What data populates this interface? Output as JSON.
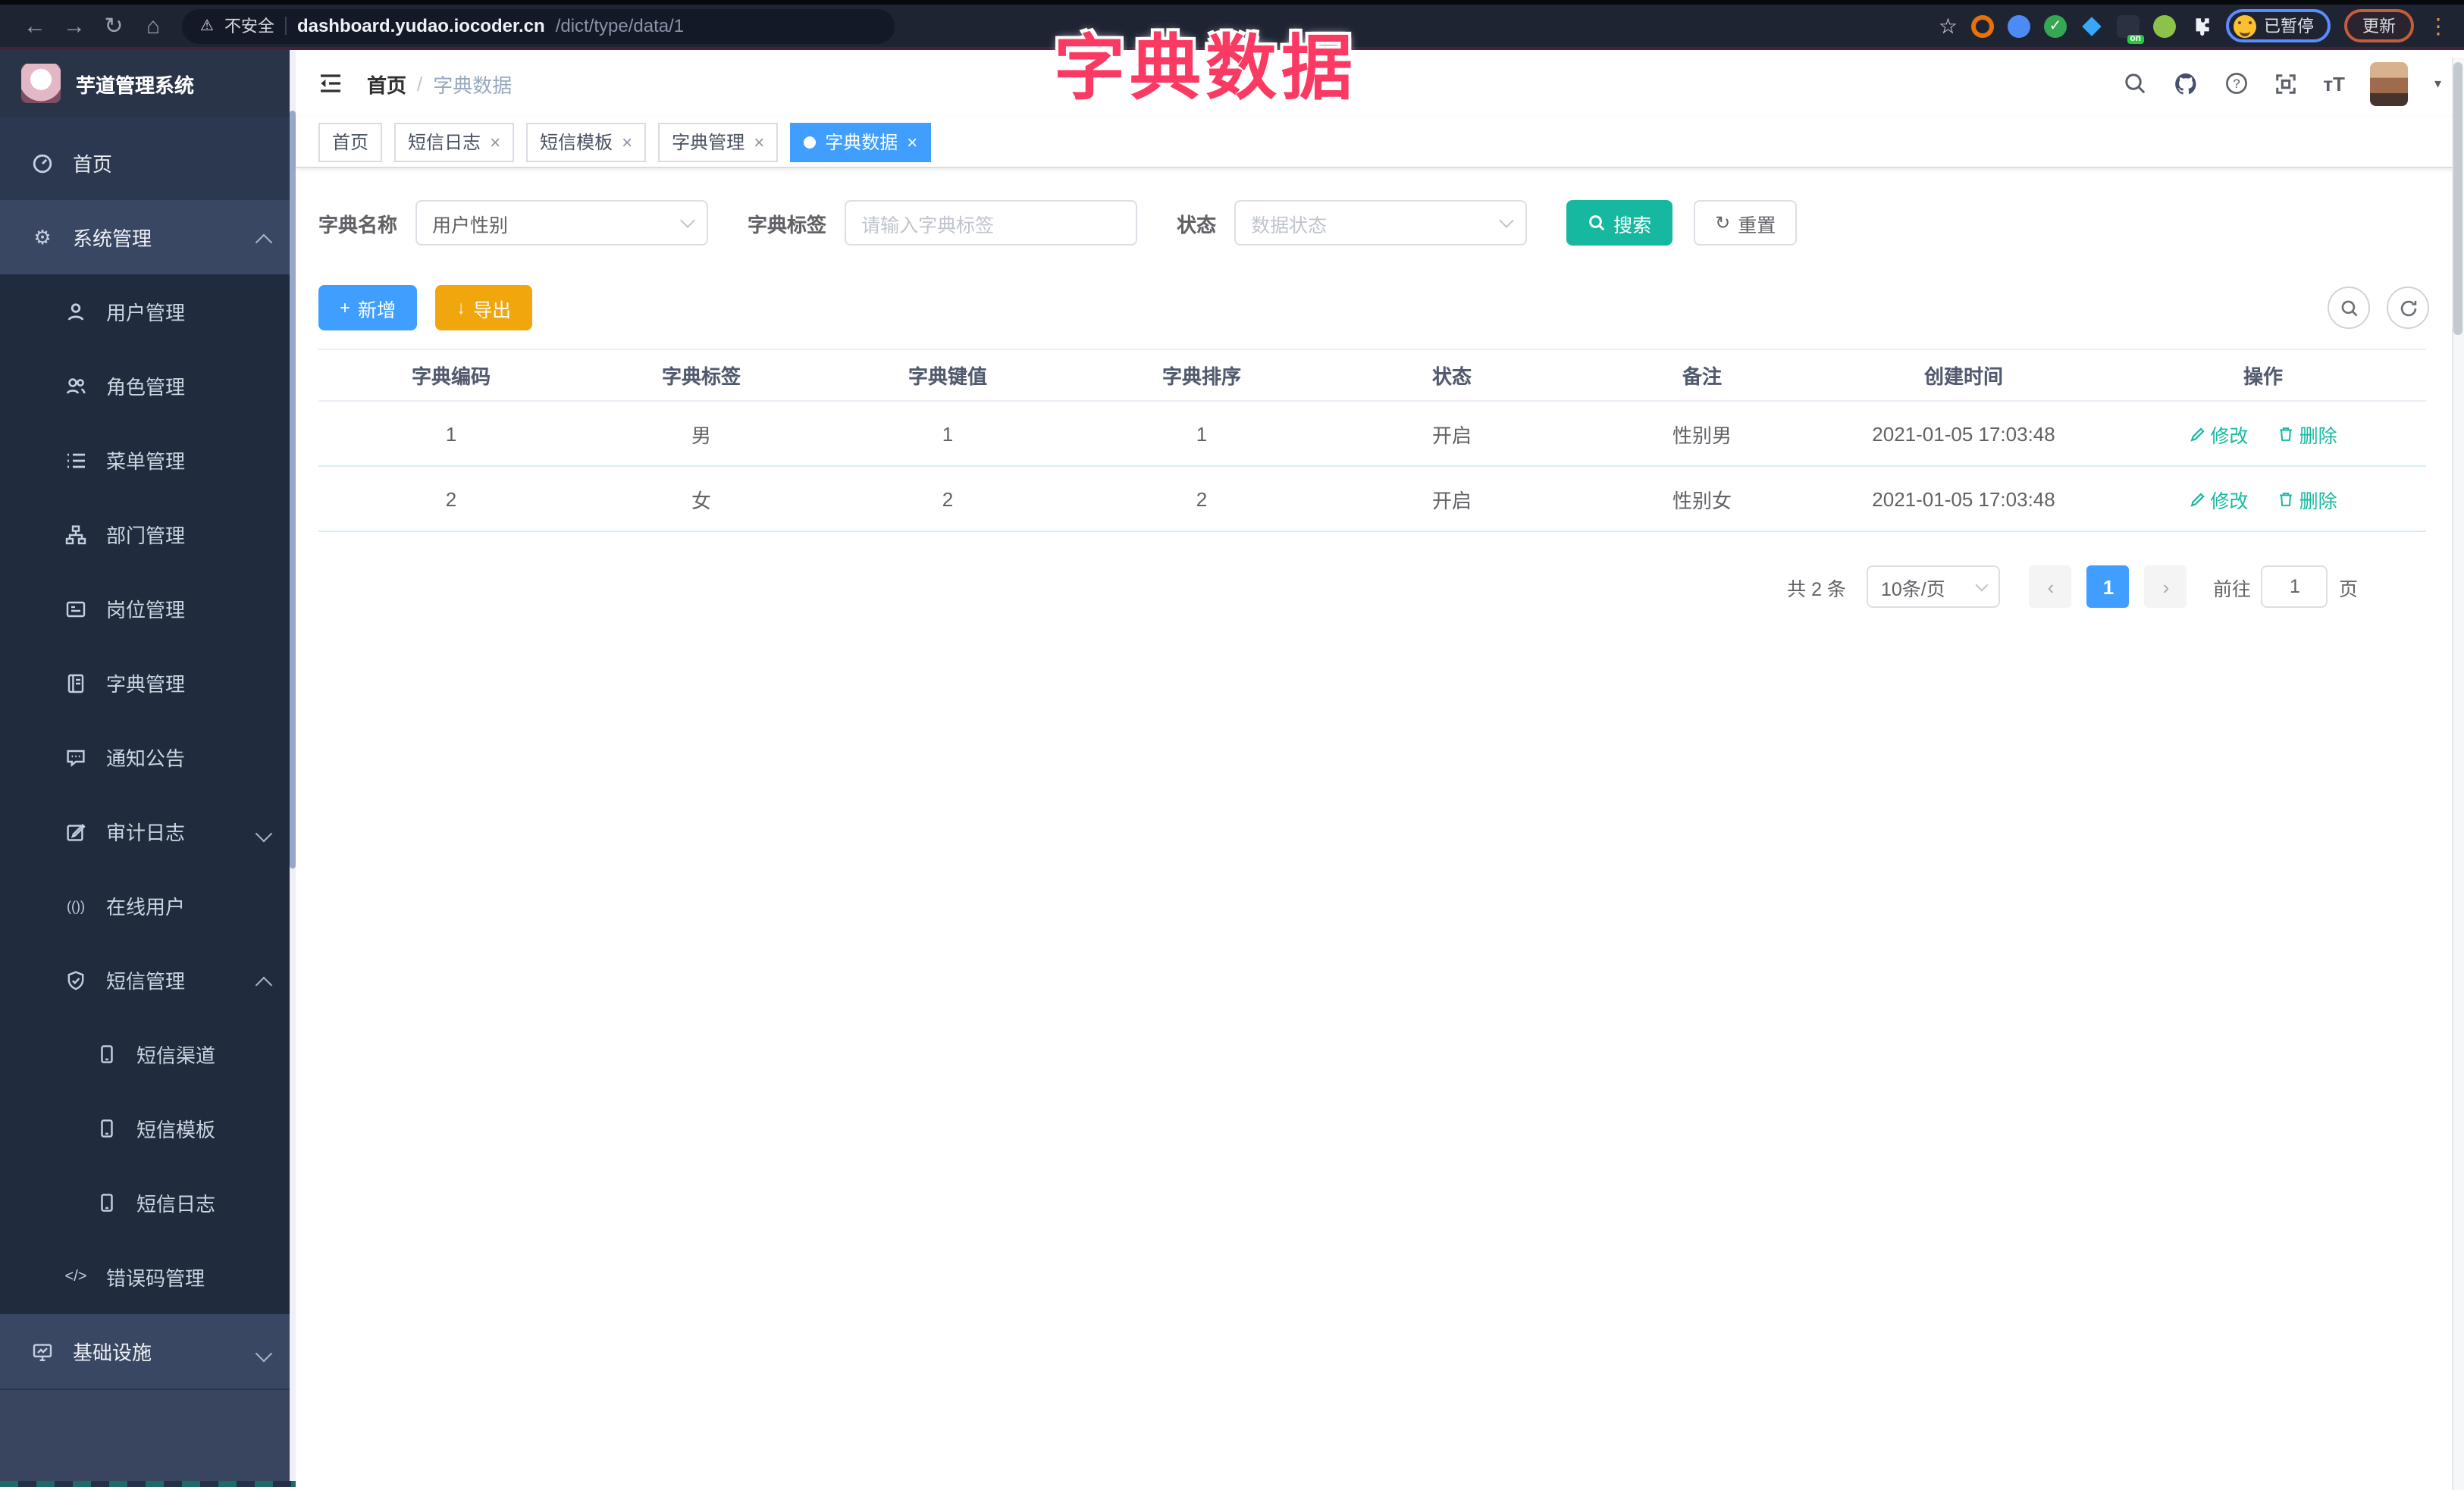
{
  "colors": {
    "primary_blue": "#409eff",
    "teal": "#16b9a0",
    "warning_orange": "#f2a60d",
    "tab_active": "#409eff",
    "overlay_pink": "#fb3a63",
    "sidebar_bg": "#2c3850",
    "submenu_bg": "#202b3e",
    "chrome_bg": "#1f2433"
  },
  "glyphs": {
    "back": "←",
    "forward": "→",
    "reload": "↻",
    "home": "⌂",
    "warning": "⚠",
    "star": "☆",
    "kebab": "⋮",
    "caret_down": "▾",
    "close": "×",
    "plus": "+",
    "download": "↓",
    "refresh": "↻",
    "angle_left": "‹",
    "angle_right": "›",
    "gear": "⚙",
    "code": "</>",
    "online": "(())",
    "font_resize": "тT",
    "ext_on_badge": "on"
  },
  "browser": {
    "insecure_label": "不安全",
    "url_host": "dashboard.yudao.iocoder.cn",
    "url_path": "/dict/type/data/1",
    "paused_label": "已暂停",
    "update_label": "更新"
  },
  "overlay_title": "字典数据",
  "sidebar": {
    "logo_title": "芋道管理系统",
    "items": [
      {
        "label": "首页"
      },
      {
        "label": "系统管理"
      },
      {
        "label": "用户管理"
      },
      {
        "label": "角色管理"
      },
      {
        "label": "菜单管理"
      },
      {
        "label": "部门管理"
      },
      {
        "label": "岗位管理"
      },
      {
        "label": "字典管理"
      },
      {
        "label": "通知公告"
      },
      {
        "label": "审计日志"
      },
      {
        "label": "在线用户"
      },
      {
        "label": "短信管理"
      },
      {
        "label": "短信渠道"
      },
      {
        "label": "短信模板"
      },
      {
        "label": "短信日志"
      },
      {
        "label": "错误码管理"
      },
      {
        "label": "基础设施"
      }
    ]
  },
  "navbar": {
    "breadcrumb_home": "首页",
    "breadcrumb_sep": "/",
    "breadcrumb_current": "字典数据"
  },
  "tabs": [
    {
      "label": "首页"
    },
    {
      "label": "短信日志"
    },
    {
      "label": "短信模板"
    },
    {
      "label": "字典管理"
    },
    {
      "label": "字典数据"
    }
  ],
  "filters": {
    "dict_name_label": "字典名称",
    "dict_name_value": "用户性别",
    "dict_label_label": "字典标签",
    "dict_label_placeholder": "请输入字典标签",
    "status_label": "状态",
    "status_placeholder": "数据状态",
    "search_label": "搜索",
    "reset_label": "重置"
  },
  "toolbar": {
    "add_label": "新增",
    "export_label": "导出"
  },
  "table": {
    "headers": [
      "字典编码",
      "字典标签",
      "字典键值",
      "字典排序",
      "状态",
      "备注",
      "创建时间",
      "操作"
    ],
    "edit_label": "修改",
    "delete_label": "删除",
    "rows": [
      {
        "code": "1",
        "label": "男",
        "value": "1",
        "sort": "1",
        "status": "开启",
        "remark": "性别男",
        "created": "2021-01-05 17:03:48"
      },
      {
        "code": "2",
        "label": "女",
        "value": "2",
        "sort": "2",
        "status": "开启",
        "remark": "性别女",
        "created": "2021-01-05 17:03:48"
      }
    ]
  },
  "pagination": {
    "total": "共 2 条",
    "page_size": "10条/页",
    "current_page": "1",
    "goto_label": "前往",
    "goto_value": "1",
    "page_unit": "页"
  }
}
